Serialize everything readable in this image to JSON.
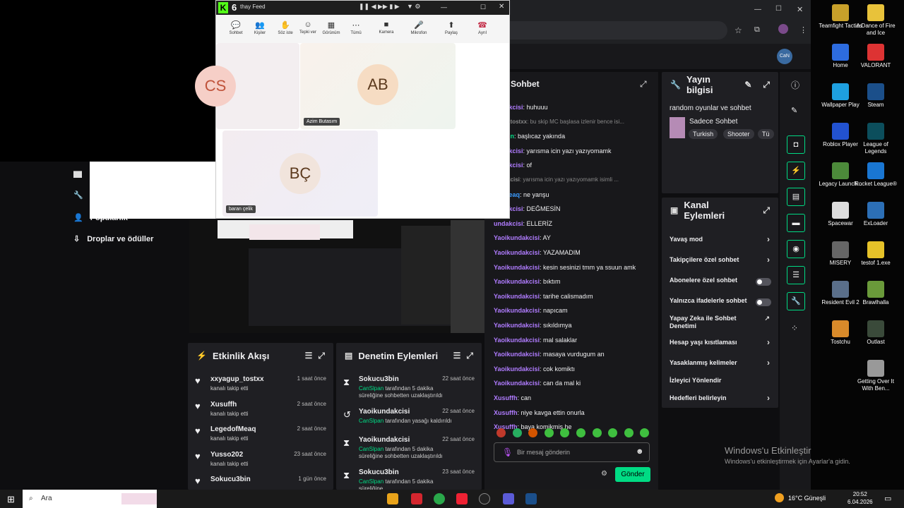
{
  "teams": {
    "title": "thay Feed",
    "toolbar": [
      {
        "label": "Sohbet",
        "icon": "chat-icon"
      },
      {
        "label": "Kişiler",
        "icon": "people-icon",
        "badge": "3"
      },
      {
        "label": "Söz iste",
        "icon": "hand-icon"
      },
      {
        "label": "Tepki ver",
        "icon": "emoji-icon"
      },
      {
        "label": "Görünüm",
        "icon": "grid-icon"
      },
      {
        "label": "Tümü",
        "icon": "more-icon"
      },
      {
        "label": "Kamera",
        "icon": "camera-icon"
      },
      {
        "label": "Mikrofon",
        "icon": "mic-icon"
      },
      {
        "label": "Paylaş",
        "icon": "share-icon"
      },
      {
        "label": "Ayrıl",
        "icon": "leave-icon"
      }
    ],
    "tiles": [
      {
        "initials": "CS",
        "name": ""
      },
      {
        "initials": "AB",
        "name": "Azim Butasım"
      },
      {
        "initials": "BÇ",
        "name": "baran çelik"
      }
    ]
  },
  "nav": {
    "drops_label": "Droplar ve ödüller",
    "partial_label": "Popülarlık"
  },
  "activity": {
    "title": "Etkinlik Akışı",
    "items": [
      {
        "name": "xxyagup_tostxx",
        "time": "1 saat önce",
        "sub": "kanalı takip etti"
      },
      {
        "name": "Xusuffh",
        "time": "2 saat önce",
        "sub": "kanalı takip etti"
      },
      {
        "name": "LegedofMeaq",
        "time": "2 saat önce",
        "sub": "kanalı takip etti"
      },
      {
        "name": "Yusso202",
        "time": "23 saat önce",
        "sub": "kanalı takip etti"
      },
      {
        "name": "Sokucu3bin",
        "time": "1 gün önce",
        "sub": ""
      }
    ]
  },
  "moderation": {
    "title": "Denetim Eylemleri",
    "items": [
      {
        "name": "Sokucu3bin",
        "time": "22 saat önce",
        "by": "CanSlpan",
        "sub": "tarafından 5 dakika süreliğine sohbetten uzaklaştırıldı"
      },
      {
        "name": "Yaoikundakcisi",
        "time": "22 saat önce",
        "by": "CanSlpan",
        "sub": "tarafından yasağı kaldırıldı"
      },
      {
        "name": "Yaoikundakcisi",
        "time": "22 saat önce",
        "by": "CanSlpan",
        "sub": "tarafından 5 dakika süreliğine sohbetten uzaklaştırıldı"
      },
      {
        "name": "Sokucu3bin",
        "time": "23 saat önce",
        "by": "CanSlpan",
        "sub": "tarafından 5 dakika süreliğine"
      }
    ]
  },
  "chat": {
    "title": "Sohbet",
    "lines": [
      {
        "user": "undakcisi",
        "text": "huhuuu",
        "color": "#b07cff"
      },
      {
        "user": "agup_tostxx",
        "text": "bu skip MC başlasa izlenir bence isi...",
        "color": "#888888",
        "dim": true
      },
      {
        "user": "cu3bin",
        "text": "başlıcaz yakında",
        "color": "#00db84"
      },
      {
        "user": "undakcisi",
        "text": "yarısma icin yazı yazıyomamk",
        "color": "#b07cff"
      },
      {
        "user": "undakcisi",
        "text": "of",
        "color": "#b07cff"
      },
      {
        "user": "undakcisi",
        "text": "yarısma icin yazı yazıyomamk isimli ...",
        "color": "#888888",
        "dim": true
      },
      {
        "user": "dofMeaq",
        "text": "ne yanşu",
        "color": "#3a9bff"
      },
      {
        "user": "undakcisi",
        "text": "DEĞMESİN",
        "color": "#b07cff"
      },
      {
        "user": "undakcisi",
        "text": "ELLERİZ",
        "color": "#b07cff"
      },
      {
        "user": "Yaoikundakcisi",
        "text": "AY",
        "color": "#b07cff"
      },
      {
        "user": "Yaoikundakcisi",
        "text": "YAZAMADIM",
        "color": "#b07cff"
      },
      {
        "user": "Yaoikundakcisi",
        "text": "kesin sesinizi tmm ya ssuun amk",
        "color": "#b07cff"
      },
      {
        "user": "Yaoikundakcisi",
        "text": "bıktım",
        "color": "#b07cff"
      },
      {
        "user": "Yaoikundakcisi",
        "text": "tarihe calismadım",
        "color": "#b07cff"
      },
      {
        "user": "Yaoikundakcisi",
        "text": "napıcam",
        "color": "#b07cff"
      },
      {
        "user": "Yaoikundakcisi",
        "text": "sıkıldımya",
        "color": "#b07cff"
      },
      {
        "user": "Yaoikundakcisi",
        "text": "mal salaklar",
        "color": "#b07cff"
      },
      {
        "user": "Yaoikundakcisi",
        "text": "masaya vurdugum an",
        "color": "#b07cff"
      },
      {
        "user": "Yaoikundakcisi",
        "text": "cok komiktı",
        "color": "#b07cff"
      },
      {
        "user": "Yaoikundakcisi",
        "text": "can da mal ki",
        "color": "#b07cff"
      },
      {
        "user": "Xusuffh",
        "text": "can",
        "color": "#b07cff"
      },
      {
        "user": "Xusuffh",
        "text": "niye kavga ettin onurla",
        "color": "#b07cff"
      },
      {
        "user": "Xusuffh",
        "text": "baya komikmiş he",
        "color": "#b07cff"
      }
    ],
    "input_placeholder": "Bir mesaj gönderin",
    "send_label": "Gönder"
  },
  "stream_info": {
    "title": "Yayın bilgisi",
    "stream_title": "random oyunlar ve sohbet",
    "category": "Sadece Sohbet",
    "tags": [
      "Turkish",
      "Shooter",
      "Tü"
    ]
  },
  "channel_actions": {
    "title": "Kanal Eylemleri",
    "items": [
      {
        "label": "Yavaş mod",
        "type": "arrow"
      },
      {
        "label": "Takipçilere özel sohbet",
        "type": "arrow"
      },
      {
        "label": "Abonelere özel sohbet",
        "type": "toggle"
      },
      {
        "label": "Yalnızca ifadelerle sohbet",
        "type": "toggle"
      },
      {
        "label": "Yapay Zeka ile Sohbet Denetimi",
        "type": "external"
      },
      {
        "label": "Hesap yaşı kısıtlaması",
        "type": "arrow"
      },
      {
        "label": "Yasaklanmış kelimeler",
        "type": "arrow"
      },
      {
        "label": "İzleyici Yönlendir",
        "type": "none"
      },
      {
        "label": "Hedefleri belirleyin",
        "type": "arrow"
      }
    ]
  },
  "desktop_icons": [
    {
      "label": "Teamfight Tactics",
      "color": "#c8a02a"
    },
    {
      "label": "A Dance of Fire and Ice",
      "color": "#e8c23a"
    },
    {
      "label": "Home",
      "color": "#2d6cdf"
    },
    {
      "label": "VALORANT",
      "color": "#d33"
    },
    {
      "label": "Wallpaper Play",
      "color": "#1ea0e0"
    },
    {
      "label": "Steam",
      "color": "#1b4f8a"
    },
    {
      "label": "Roblox Player",
      "color": "#2252d0"
    },
    {
      "label": "League of Legends",
      "color": "#0c4e5c"
    },
    {
      "label": "Legacy Launch...",
      "color": "#4c8a3a"
    },
    {
      "label": "Rocket League®",
      "color": "#1976d2"
    },
    {
      "label": "Spacewar",
      "color": "#ddd"
    },
    {
      "label": "ExLoader",
      "color": "#2c6fb6"
    },
    {
      "label": "MISERY",
      "color": "#666"
    },
    {
      "label": "testof 1.exe",
      "color": "#e6c229"
    },
    {
      "label": "Resident Evil 2",
      "color": "#5a6f8a"
    },
    {
      "label": "Brawlhalla",
      "color": "#6a9a3a"
    },
    {
      "label": "Tostchu",
      "color": "#d88a2a"
    },
    {
      "label": "Outlast",
      "color": "#3a4a3a"
    },
    {
      "label": "Getting Over It With Ben...",
      "color": "#999"
    }
  ],
  "activation": {
    "line1": "Windows'u Etkinleştir",
    "line2": "Windows'u etkinleştirmek için Ayarlar'a gidin."
  },
  "taskbar": {
    "search": "Ara",
    "weather": "16°C  Güneşli",
    "time": "20:52",
    "date": "6.04.2026"
  }
}
